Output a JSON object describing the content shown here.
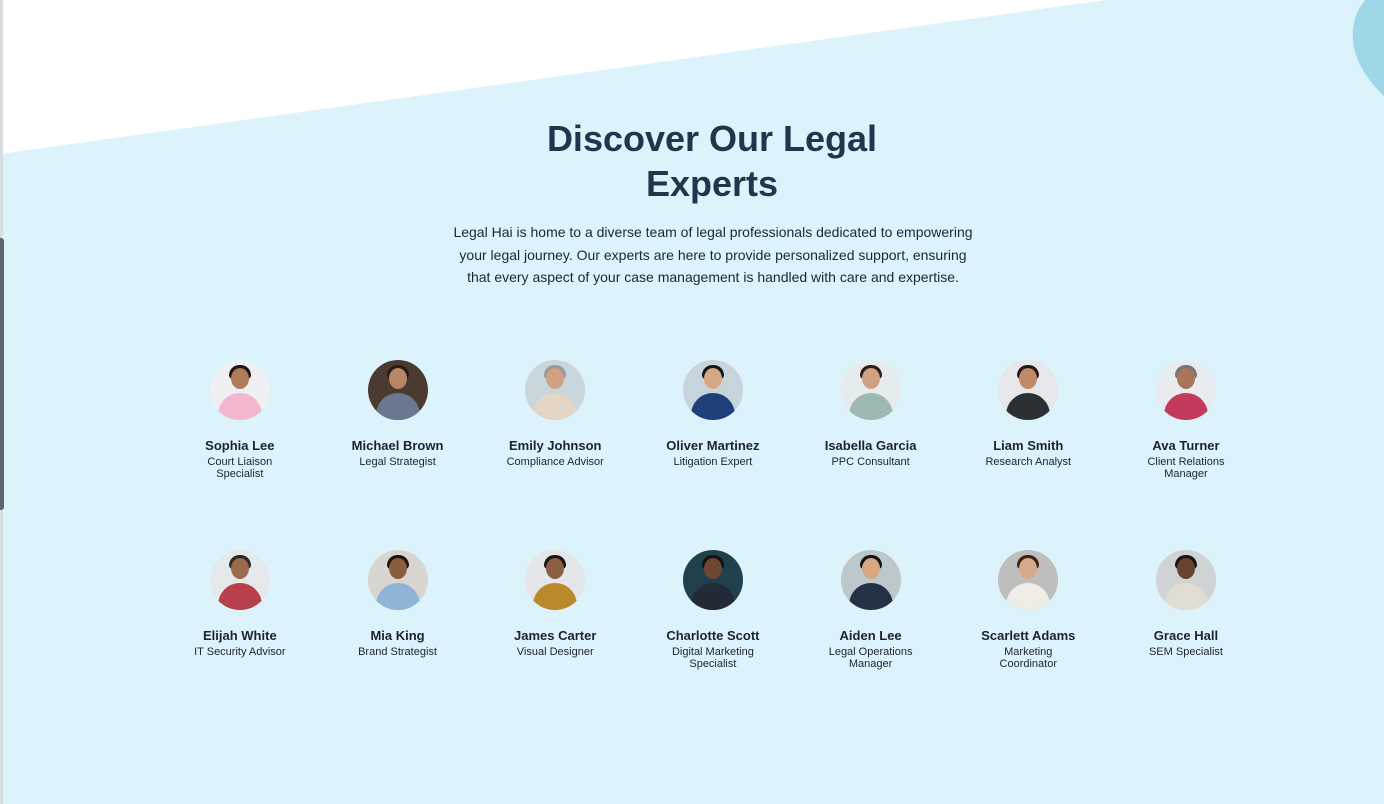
{
  "section": {
    "title_line1": "Discover Our Legal",
    "title_line2": "Experts",
    "description": "Legal Hai is home to a diverse team of legal professionals dedicated to empowering your legal journey. Our experts are here to provide personalized support, ensuring that every aspect of your case management is handled with care and expertise."
  },
  "colors": {
    "background": "#dcf3fc",
    "white_band": "#ffffff",
    "corner_accent": "#9ed8e8",
    "heading": "#21354d"
  },
  "experts": [
    {
      "name": "Sophia Lee",
      "role": "Court Liaison Specialist",
      "photo": {
        "bg": "#eef0f3",
        "skin": "#b07a5c",
        "hair": "#1e1712",
        "shirt": "#f2b7cf"
      }
    },
    {
      "name": "Michael Brown",
      "role": "Legal Strategist",
      "photo": {
        "bg": "#4a3a30",
        "skin": "#b88666",
        "hair": "#2a1c14",
        "shirt": "#6a7890"
      }
    },
    {
      "name": "Emily Johnson",
      "role": "Compliance Advisor",
      "photo": {
        "bg": "#c9d6dc",
        "skin": "#d1a184",
        "hair": "#9a9a9a",
        "shirt": "#e4d6c4"
      }
    },
    {
      "name": "Oliver Martinez",
      "role": "Litigation Expert",
      "photo": {
        "bg": "#c7d4dc",
        "skin": "#d7a884",
        "hair": "#161616",
        "shirt": "#1f3f7a"
      }
    },
    {
      "name": "Isabella Garcia",
      "role": "PPC Consultant",
      "photo": {
        "bg": "#e6ecee",
        "skin": "#d1a184",
        "hair": "#2a1e18",
        "shirt": "#9fb8b4"
      }
    },
    {
      "name": "Liam Smith",
      "role": "Research Analyst",
      "photo": {
        "bg": "#e5e7ea",
        "skin": "#c08a68",
        "hair": "#221812",
        "shirt": "#2b3034"
      }
    },
    {
      "name": "Ava Turner",
      "role": "Client Relations Manager",
      "photo": {
        "bg": "#e9ecee",
        "skin": "#a8765a",
        "hair": "#777777",
        "shirt": "#c23a5c"
      }
    },
    {
      "name": "Elijah White",
      "role": "IT Security Advisor",
      "photo": {
        "bg": "#e6e9ec",
        "skin": "#9c6a4c",
        "hair": "#2a2a2a",
        "shirt": "#b8404c"
      }
    },
    {
      "name": "Mia King",
      "role": "Brand Strategist",
      "photo": {
        "bg": "#d9d6d2",
        "skin": "#8a5c40",
        "hair": "#1e140e",
        "shirt": "#8fb4d8"
      }
    },
    {
      "name": "James Carter",
      "role": "Visual Designer",
      "photo": {
        "bg": "#e4e6ea",
        "skin": "#8c5e42",
        "hair": "#1a1410",
        "shirt": "#b88a2a"
      }
    },
    {
      "name": "Charlotte Scott",
      "role": "Digital Marketing Specialist",
      "photo": {
        "bg": "#20404e",
        "skin": "#6e4632",
        "hair": "#161210",
        "shirt": "#222a36"
      }
    },
    {
      "name": "Aiden Lee",
      "role": "Legal Operations Manager",
      "photo": {
        "bg": "#bcc8cc",
        "skin": "#d7a884",
        "hair": "#141414",
        "shirt": "#243248"
      }
    },
    {
      "name": "Scarlett Adams",
      "role": "Marketing Coordinator",
      "photo": {
        "bg": "#bebebe",
        "skin": "#d8aa8c",
        "hair": "#3a2418",
        "shirt": "#f0ece6"
      }
    },
    {
      "name": "Grace Hall",
      "role": "SEM Specialist",
      "photo": {
        "bg": "#cfd3d6",
        "skin": "#6a4230",
        "hair": "#161616",
        "shirt": "#e2ddd2"
      }
    }
  ]
}
